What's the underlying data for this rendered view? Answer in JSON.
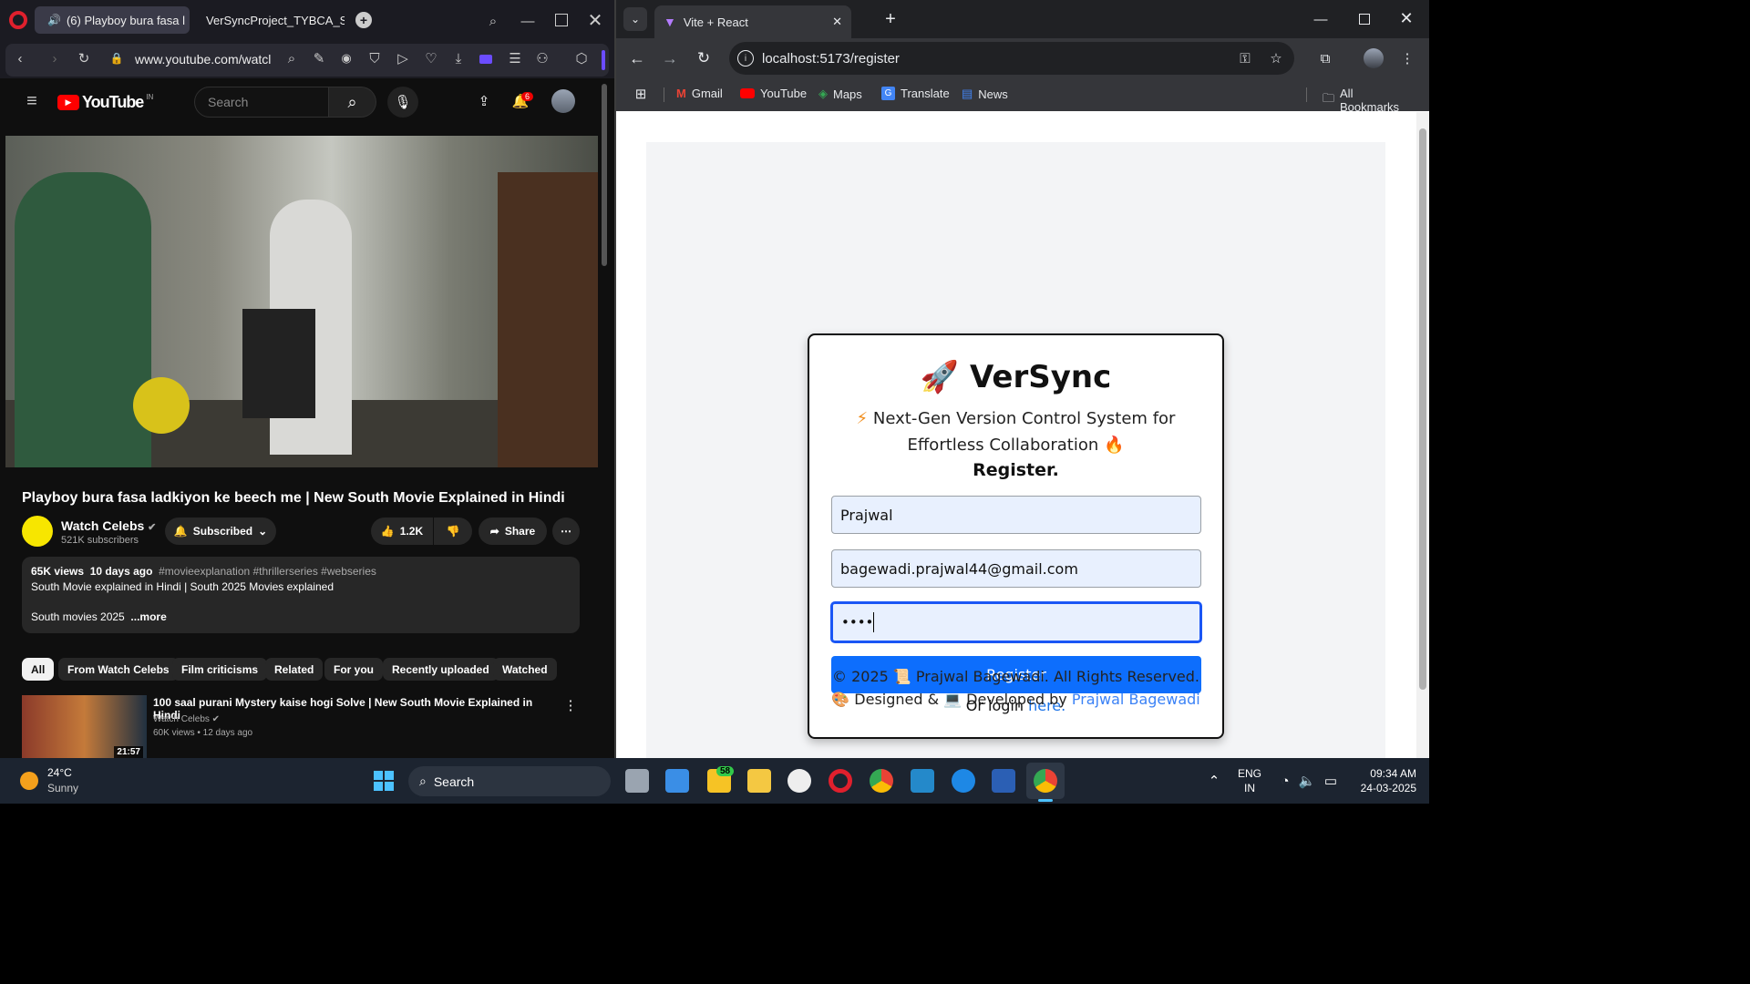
{
  "opera": {
    "tabs": [
      {
        "label": "(6) Playboy bura fasa l",
        "icon": "youtube-audio-icon"
      },
      {
        "label": "VerSyncProject_TYBCA_SE",
        "icon": "github-icon"
      }
    ],
    "url": "www.youtube.com/watcl",
    "youtube": {
      "logo_text": "YouTube",
      "region": "IN",
      "search_placeholder": "Search",
      "notifications": "6",
      "video_title": "Playboy bura fasa ladkiyon ke beech me | New South Movie Explained in Hindi",
      "channel": "Watch Celebs",
      "subscribers": "521K subscribers",
      "subscribed_label": "Subscribed",
      "likes": "1.2K",
      "share_label": "Share",
      "views": "65K views",
      "age": "10 days ago",
      "hashtags": "#movieexplanation #thrillerseries #webseries",
      "desc_line1": "South Movie explained in Hindi | South 2025 Movies explained",
      "desc_line2": "South movies 2025",
      "more_label": "...more",
      "chips": [
        "All",
        "From Watch Celebs",
        "Film criticisms",
        "Related",
        "For you",
        "Recently uploaded",
        "Watched"
      ],
      "rec": {
        "title": "100 saal purani Mystery kaise hogi Solve | New South Movie Explained in Hindi",
        "channel": "Watch Celebs",
        "meta": "60K views • 12 days ago",
        "duration": "21:57"
      }
    }
  },
  "chrome": {
    "tab_title": "Vite + React",
    "url": "localhost:5173/register",
    "bookmarks": [
      "Gmail",
      "YouTube",
      "Maps",
      "Translate",
      "News"
    ],
    "all_bookmarks": "All Bookmarks",
    "app": {
      "brand": "VerSync",
      "tagline1": "Next-Gen Version Control System for",
      "tagline2": "Effortless Collaboration",
      "heading": "Register.",
      "name_value": "Prajwal",
      "email_value": "bagewadi.prajwal44@gmail.com",
      "password_value": "••••",
      "register_label": "Register",
      "login_prefix": "Or login ",
      "login_link": "here.",
      "footer_line1": "© 2025 📜 Prajwal Bagewadi. All Rights Reserved.",
      "footer_prefix": "🎨 Designed & 💻 Developed by ",
      "footer_link": "Prajwal Bagewadi"
    }
  },
  "taskbar": {
    "temperature": "24°C",
    "weather": "Sunny",
    "search_label": "Search",
    "badge": "58",
    "lang1": "ENG",
    "lang2": "IN",
    "time": "09:34 AM",
    "date": "24-03-2025"
  }
}
